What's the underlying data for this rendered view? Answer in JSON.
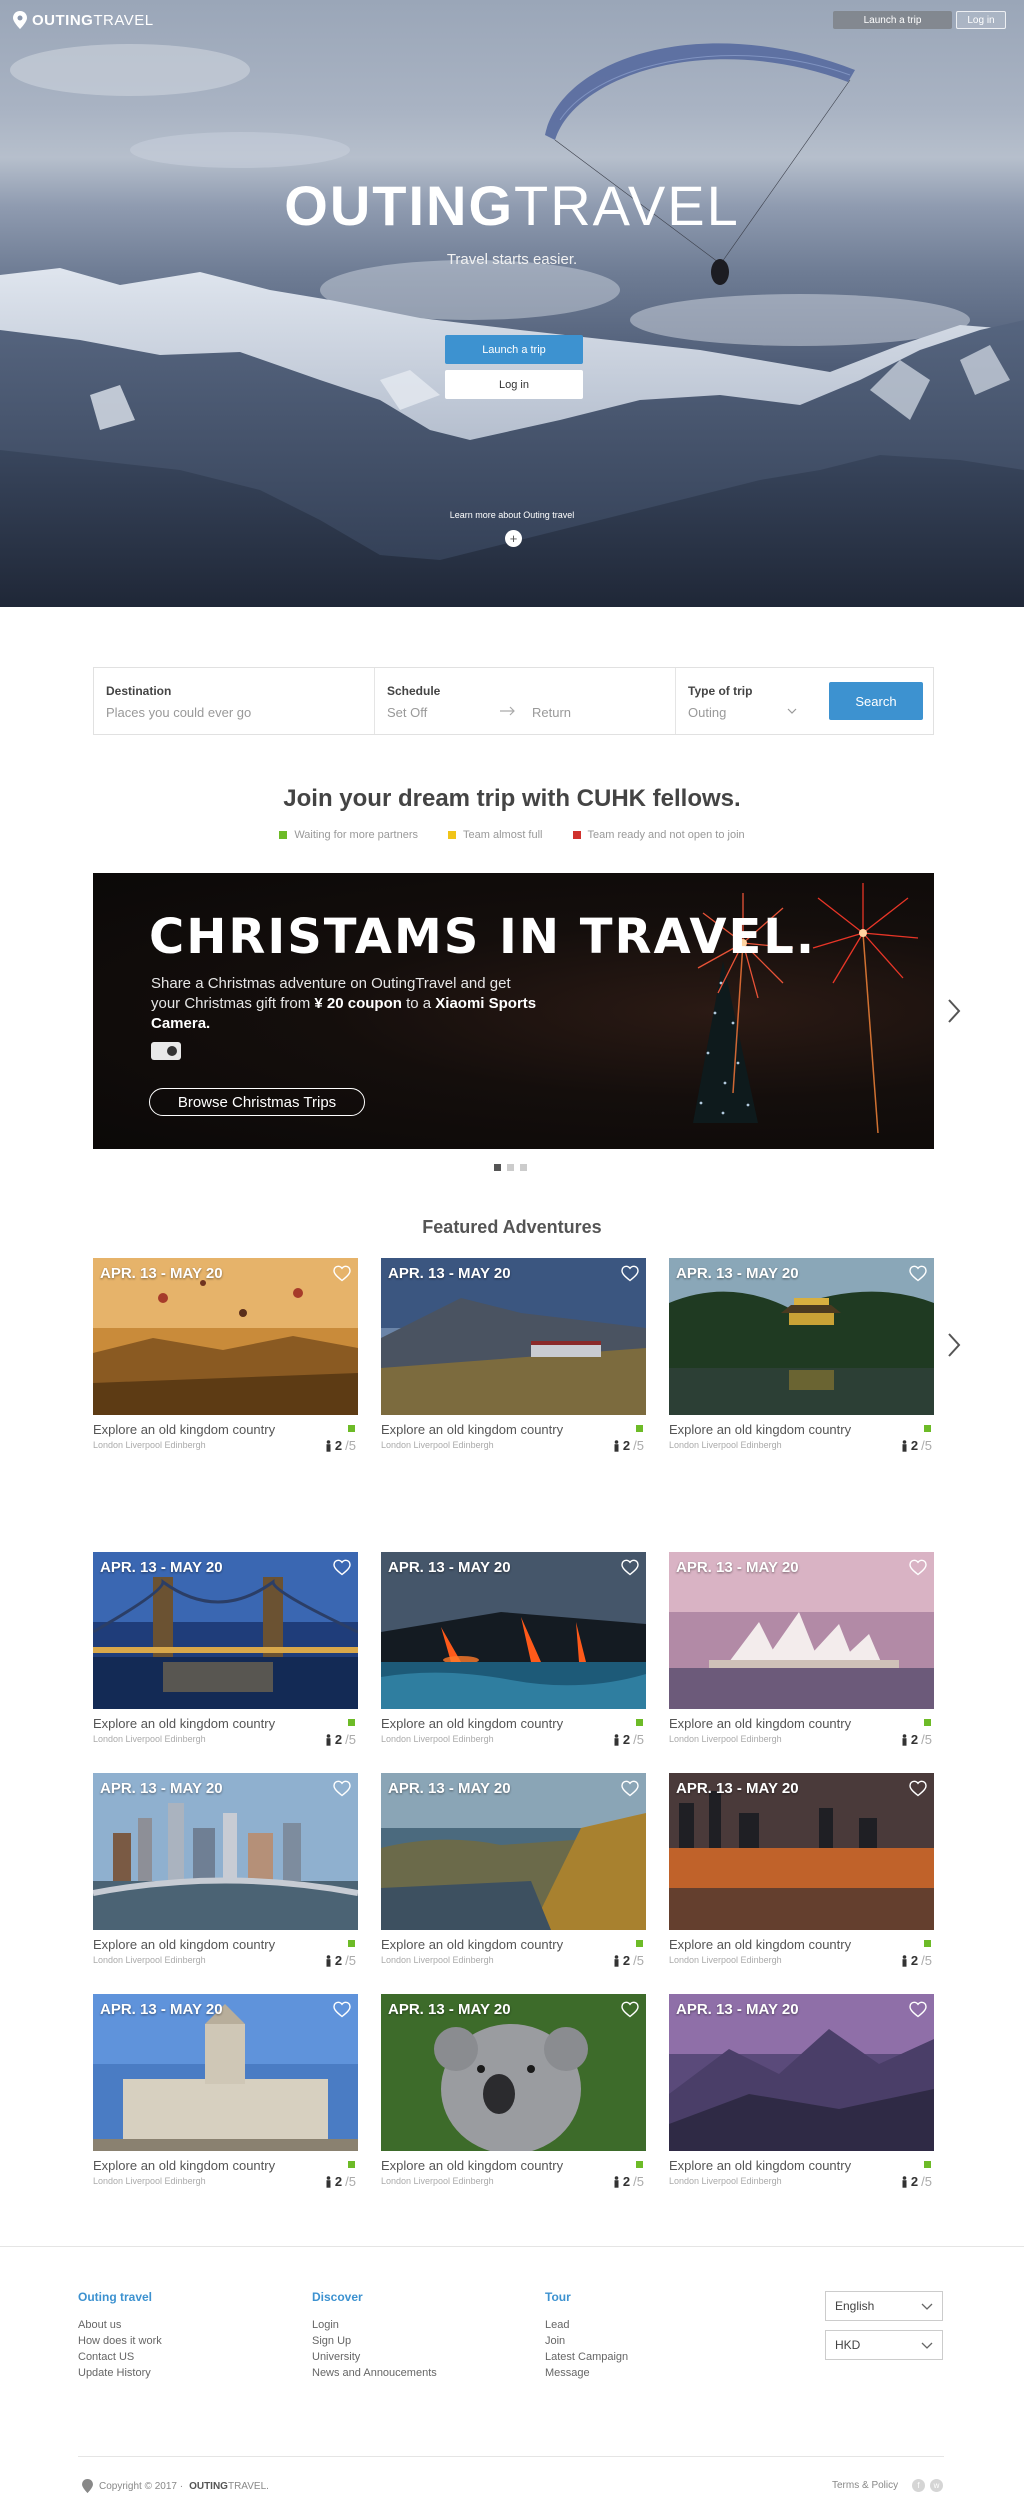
{
  "brand": {
    "name_bold": "OUTING",
    "name_light": "TRAVEL"
  },
  "topbar": {
    "launch_label": "Launch a trip",
    "login_label": "Log in"
  },
  "hero": {
    "title_bold": "OUTING",
    "title_light": "TRAVEL",
    "subtitle": "Travel starts easier.",
    "launch_label": "Launch a trip",
    "login_label": "Log in",
    "learn_more": "Learn more about Outing travel",
    "plus_symbol": "+"
  },
  "search": {
    "destination_label": "Destination",
    "destination_placeholder": "Places you could ever go",
    "schedule_label": "Schedule",
    "set_off_placeholder": "Set Off",
    "return_placeholder": "Return",
    "type_label": "Type of trip",
    "type_value": "Outing",
    "button_label": "Search"
  },
  "join": {
    "title": "Join your dream trip with CUHK fellows.",
    "legend": [
      {
        "label": "Waiting for more partners",
        "color": "#6dbb27"
      },
      {
        "label": "Team almost full",
        "color": "#f0c419"
      },
      {
        "label": "Team ready and not open to join",
        "color": "#d0312d"
      }
    ]
  },
  "banner": {
    "title": "CHRISTAMS IN TRAVEL.",
    "text_1": "Share a Christmas adventure on OutingTravel and get your Christmas gift from",
    "coupon": "¥ 20 coupon",
    "text_2": "to a",
    "product": "Xiaomi Sports Camera.",
    "button_label": "Browse Christmas Trips",
    "slide_count": 3,
    "active_slide": 1
  },
  "featured": {
    "title": "Featured Adventures",
    "cards": [
      {
        "date": "APR. 13 - MAY 20",
        "title": "Explore an old kingdom country",
        "cities": "London  Liverpool  Edinbergh",
        "joined": "2",
        "total": "/5",
        "scene": "balloons",
        "status_color": "#6dbb27"
      },
      {
        "date": "APR. 13 - MAY 20",
        "title": "Explore an old kingdom country",
        "cities": "London  Liverpool  Edinbergh",
        "joined": "2",
        "total": "/5",
        "scene": "train",
        "status_color": "#6dbb27"
      },
      {
        "date": "APR. 13 - MAY 20",
        "title": "Explore an old kingdom country",
        "cities": "London  Liverpool  Edinbergh",
        "joined": "2",
        "total": "/5",
        "scene": "temple",
        "status_color": "#6dbb27"
      },
      {
        "date": "APR. 13 - MAY 20",
        "title": "Explore an old kingdom country",
        "cities": "London  Liverpool  Edinbergh",
        "joined": "2",
        "total": "/5",
        "scene": "bridge",
        "status_color": "#6dbb27"
      },
      {
        "date": "APR. 13 - MAY 20",
        "title": "Explore an old kingdom country",
        "cities": "London  Liverpool  Edinbergh",
        "joined": "2",
        "total": "/5",
        "scene": "lava",
        "status_color": "#6dbb27"
      },
      {
        "date": "APR. 13 - MAY 20",
        "title": "Explore an old kingdom country",
        "cities": "London  Liverpool  Edinbergh",
        "joined": "2",
        "total": "/5",
        "scene": "opera",
        "status_color": "#6dbb27"
      },
      {
        "date": "APR. 13 - MAY 20",
        "title": "Explore an old kingdom country",
        "cities": "London  Liverpool  Edinbergh",
        "joined": "2",
        "total": "/5",
        "scene": "city",
        "status_color": "#6dbb27"
      },
      {
        "date": "APR. 13 - MAY 20",
        "title": "Explore an old kingdom country",
        "cities": "London  Liverpool  Edinbergh",
        "joined": "2",
        "total": "/5",
        "scene": "cliffs",
        "status_color": "#6dbb27"
      },
      {
        "date": "APR. 13 - MAY 20",
        "title": "Explore an old kingdom country",
        "cities": "London  Liverpool  Edinbergh",
        "joined": "2",
        "total": "/5",
        "scene": "sunset",
        "status_color": "#6dbb27"
      },
      {
        "date": "APR. 13 - MAY 20",
        "title": "Explore an old kingdom country",
        "cities": "London  Liverpool  Edinbergh",
        "joined": "2",
        "total": "/5",
        "scene": "building",
        "status_color": "#6dbb27"
      },
      {
        "date": "APR. 13 - MAY 20",
        "title": "Explore an old kingdom country",
        "cities": "London  Liverpool  Edinbergh",
        "joined": "2",
        "total": "/5",
        "scene": "koala",
        "status_color": "#6dbb27"
      },
      {
        "date": "APR. 13 - MAY 20",
        "title": "Explore an old kingdom country",
        "cities": "London  Liverpool  Edinbergh",
        "joined": "2",
        "total": "/5",
        "scene": "mountains",
        "status_color": "#6dbb27"
      }
    ]
  },
  "footer": {
    "columns": [
      {
        "heading": "Outing travel",
        "links": [
          "About us",
          "How does it work",
          "Contact US",
          "Update History"
        ]
      },
      {
        "heading": "Discover",
        "links": [
          "Login",
          "Sign Up",
          "University",
          "News and Annoucements"
        ]
      },
      {
        "heading": "Tour",
        "links": [
          "Lead",
          "Join",
          "Latest Campaign",
          "Message"
        ]
      }
    ],
    "language": "English",
    "currency": "HKD",
    "copyright": "Copyright © 2017 ·",
    "copyright_bold": "OUTING",
    "copyright_light": "TRAVEL.",
    "terms": "Terms & Policy",
    "social": [
      "facebook-icon",
      "weibo-icon"
    ],
    "social_glyphs": [
      "f",
      "w"
    ]
  },
  "colors": {
    "accent": "#3d92d0",
    "green": "#6dbb27",
    "yellow": "#f0c419",
    "red": "#d0312d"
  }
}
